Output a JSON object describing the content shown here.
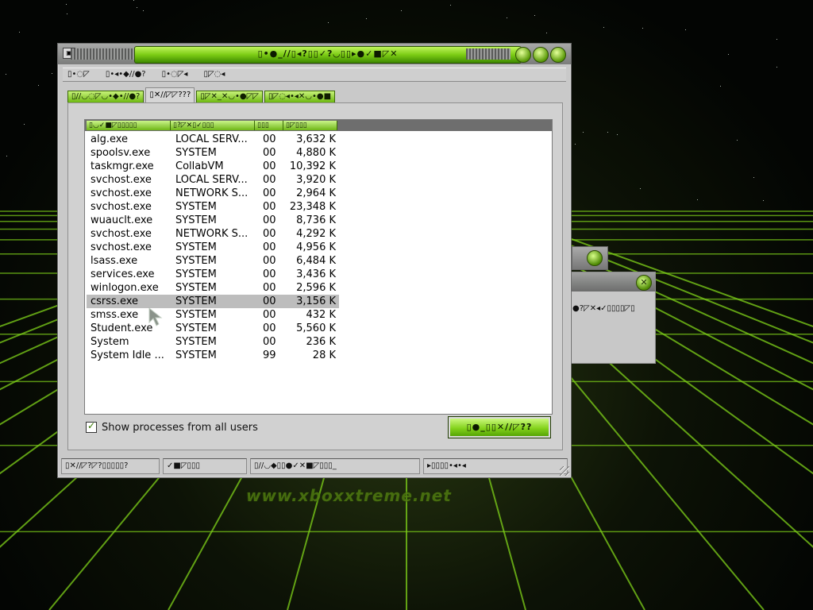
{
  "colors": {
    "accent_green": "#7ccc14",
    "window_gray": "#c9c9c9",
    "selection_gray": "#bdbdbd"
  },
  "desktop": {
    "watermark": "www.xboxxtreme.net"
  },
  "window": {
    "title": "▯•●_//▯◂?▯▯✓?◡▯▯▸●✓■◸✕",
    "system_icon": "xbox-logo-icon",
    "title_buttons": [
      "minimize-icon",
      "maximize-icon",
      "close-icon"
    ]
  },
  "menu": [
    "▯•◌◸",
    "▯•◂•◆//●?",
    "▯•◌◸◂",
    "▯◸◌◂"
  ],
  "tabs": [
    {
      "label": "▯//◡◌◸◡•◆•//●?",
      "active": false
    },
    {
      "label": "▯✕//◸◸???",
      "active": true
    },
    {
      "label": "▯◸✕_✕◡•●◸◸",
      "active": false
    },
    {
      "label": "▯◸◌◂•◂✕◡•●■",
      "active": false
    }
  ],
  "list": {
    "columns": [
      "▯◡✓■◸▯▯▯▯▯",
      "▯?◸✕▯✓▯▯▯",
      "▯▯▯",
      "▯◸▯▯▯"
    ],
    "rows": [
      {
        "name": "alg.exe",
        "user": "LOCAL SERV...",
        "cpu": "00",
        "mem": "3,632 K"
      },
      {
        "name": "spoolsv.exe",
        "user": "SYSTEM",
        "cpu": "00",
        "mem": "4,880 K"
      },
      {
        "name": "taskmgr.exe",
        "user": "CollabVM",
        "cpu": "00",
        "mem": "10,392 K"
      },
      {
        "name": "svchost.exe",
        "user": "LOCAL SERV...",
        "cpu": "00",
        "mem": "3,920 K"
      },
      {
        "name": "svchost.exe",
        "user": "NETWORK S...",
        "cpu": "00",
        "mem": "2,964 K"
      },
      {
        "name": "svchost.exe",
        "user": "SYSTEM",
        "cpu": "00",
        "mem": "23,348 K"
      },
      {
        "name": "wuauclt.exe",
        "user": "SYSTEM",
        "cpu": "00",
        "mem": "8,736 K"
      },
      {
        "name": "svchost.exe",
        "user": "NETWORK S...",
        "cpu": "00",
        "mem": "4,292 K"
      },
      {
        "name": "svchost.exe",
        "user": "SYSTEM",
        "cpu": "00",
        "mem": "4,956 K"
      },
      {
        "name": "lsass.exe",
        "user": "SYSTEM",
        "cpu": "00",
        "mem": "6,484 K"
      },
      {
        "name": "services.exe",
        "user": "SYSTEM",
        "cpu": "00",
        "mem": "3,436 K"
      },
      {
        "name": "winlogon.exe",
        "user": "SYSTEM",
        "cpu": "00",
        "mem": "2,596 K"
      },
      {
        "name": "csrss.exe",
        "user": "SYSTEM",
        "cpu": "00",
        "mem": "3,156 K",
        "selected": true
      },
      {
        "name": "smss.exe",
        "user": "SYSTEM",
        "cpu": "00",
        "mem": "432 K"
      },
      {
        "name": "Student.exe",
        "user": "SYSTEM",
        "cpu": "00",
        "mem": "5,560 K"
      },
      {
        "name": "System",
        "user": "SYSTEM",
        "cpu": "00",
        "mem": "236 K"
      },
      {
        "name": "System Idle ...",
        "user": "SYSTEM",
        "cpu": "99",
        "mem": "28 K"
      }
    ]
  },
  "show_all_users": {
    "label": "Show processes from all users",
    "checked": true
  },
  "end_process_button": "▯●_▯▯✕//◸??",
  "statusbar": [
    "▯✕//◸?◸?▯▯▯▯▯?",
    "✓■◸▯▯▯",
    "▯//◡◆▯▯●✓✕■◸▯▯▯_",
    "▸▯▯▯▯•◂•◂"
  ],
  "background_dialog": {
    "text": "●?◸✕◂✓▯▯▯▯◸▯"
  }
}
